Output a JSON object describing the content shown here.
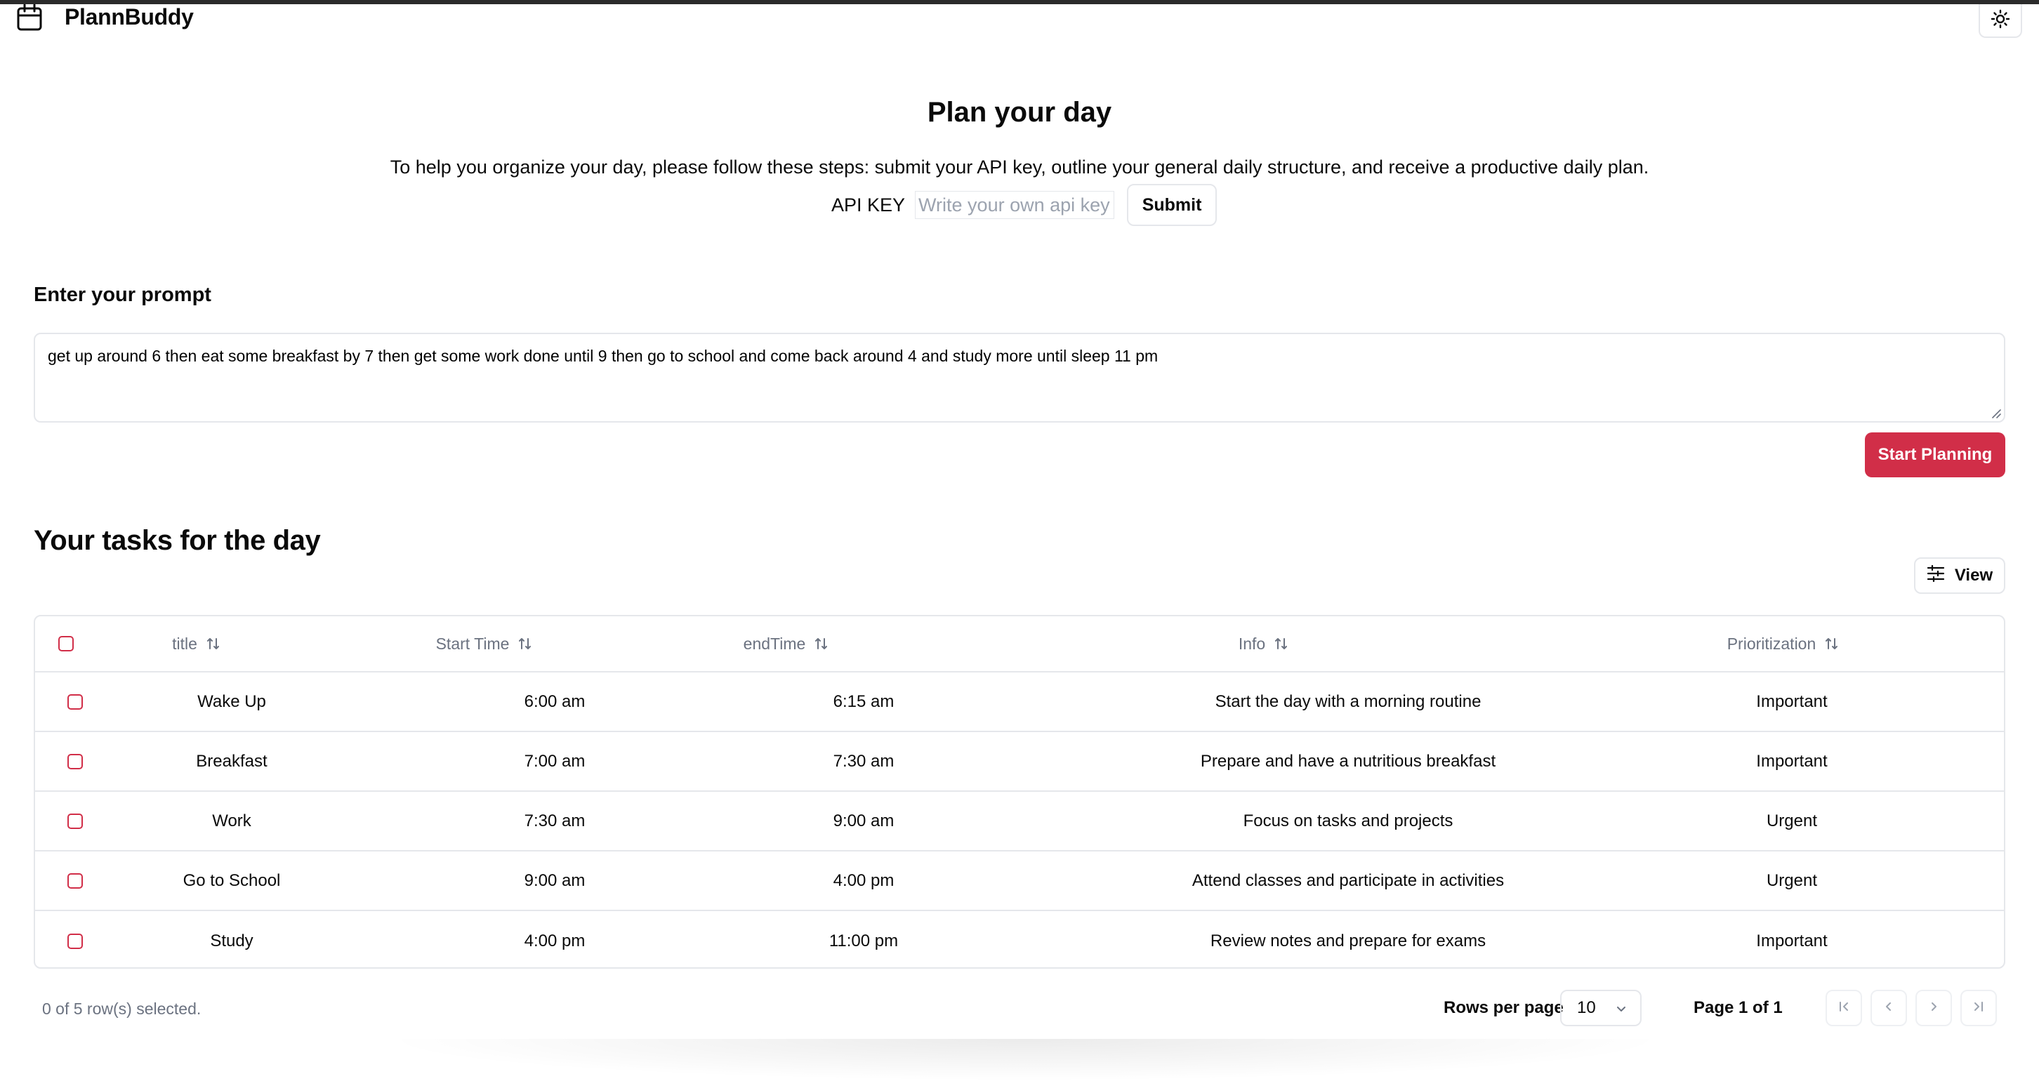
{
  "app": {
    "title": "PlannBuddy"
  },
  "hero": {
    "title": "Plan your day",
    "description": "To help you organize your day, please follow these steps: submit your API key, outline your general daily structure, and receive a productive daily plan.",
    "api_label": "API KEY",
    "api_placeholder": "Write your own api key",
    "api_value": "",
    "submit_label": "Submit"
  },
  "prompt": {
    "label": "Enter your prompt",
    "value": "get up around 6 then eat some breakfast by 7 then get some work done until 9 then go to school and come back around 4 and study more until sleep 11 pm",
    "start_label": "Start Planning"
  },
  "tasks": {
    "title": "Your tasks for the day",
    "view_label": "View",
    "columns": [
      "title",
      "Start Time",
      "endTime",
      "Info",
      "Prioritization"
    ],
    "rows": [
      {
        "title": "Wake Up",
        "start": "6:00 am",
        "end": "6:15 am",
        "info": "Start the day with a morning routine",
        "priority": "Important"
      },
      {
        "title": "Breakfast",
        "start": "7:00 am",
        "end": "7:30 am",
        "info": "Prepare and have a nutritious breakfast",
        "priority": "Important"
      },
      {
        "title": "Work",
        "start": "7:30 am",
        "end": "9:00 am",
        "info": "Focus on tasks and projects",
        "priority": "Urgent"
      },
      {
        "title": "Go to School",
        "start": "9:00 am",
        "end": "4:00 pm",
        "info": "Attend classes and participate in activities",
        "priority": "Urgent"
      },
      {
        "title": "Study",
        "start": "4:00 pm",
        "end": "11:00 pm",
        "info": "Review notes and prepare for exams",
        "priority": "Important"
      }
    ]
  },
  "footer": {
    "selection": "0 of 5 row(s) selected.",
    "rows_per_page_label": "Rows per page",
    "rows_per_page_value": "10",
    "page_info": "Page 1 of 1"
  },
  "colors": {
    "accent": "#d12e48",
    "border": "#e5e7eb",
    "muted": "#6b7280"
  },
  "icons": [
    "calendar-icon",
    "sun-icon",
    "sliders-icon",
    "sort-icon",
    "chevron-down-icon",
    "first-page-icon",
    "prev-page-icon",
    "next-page-icon",
    "last-page-icon"
  ]
}
